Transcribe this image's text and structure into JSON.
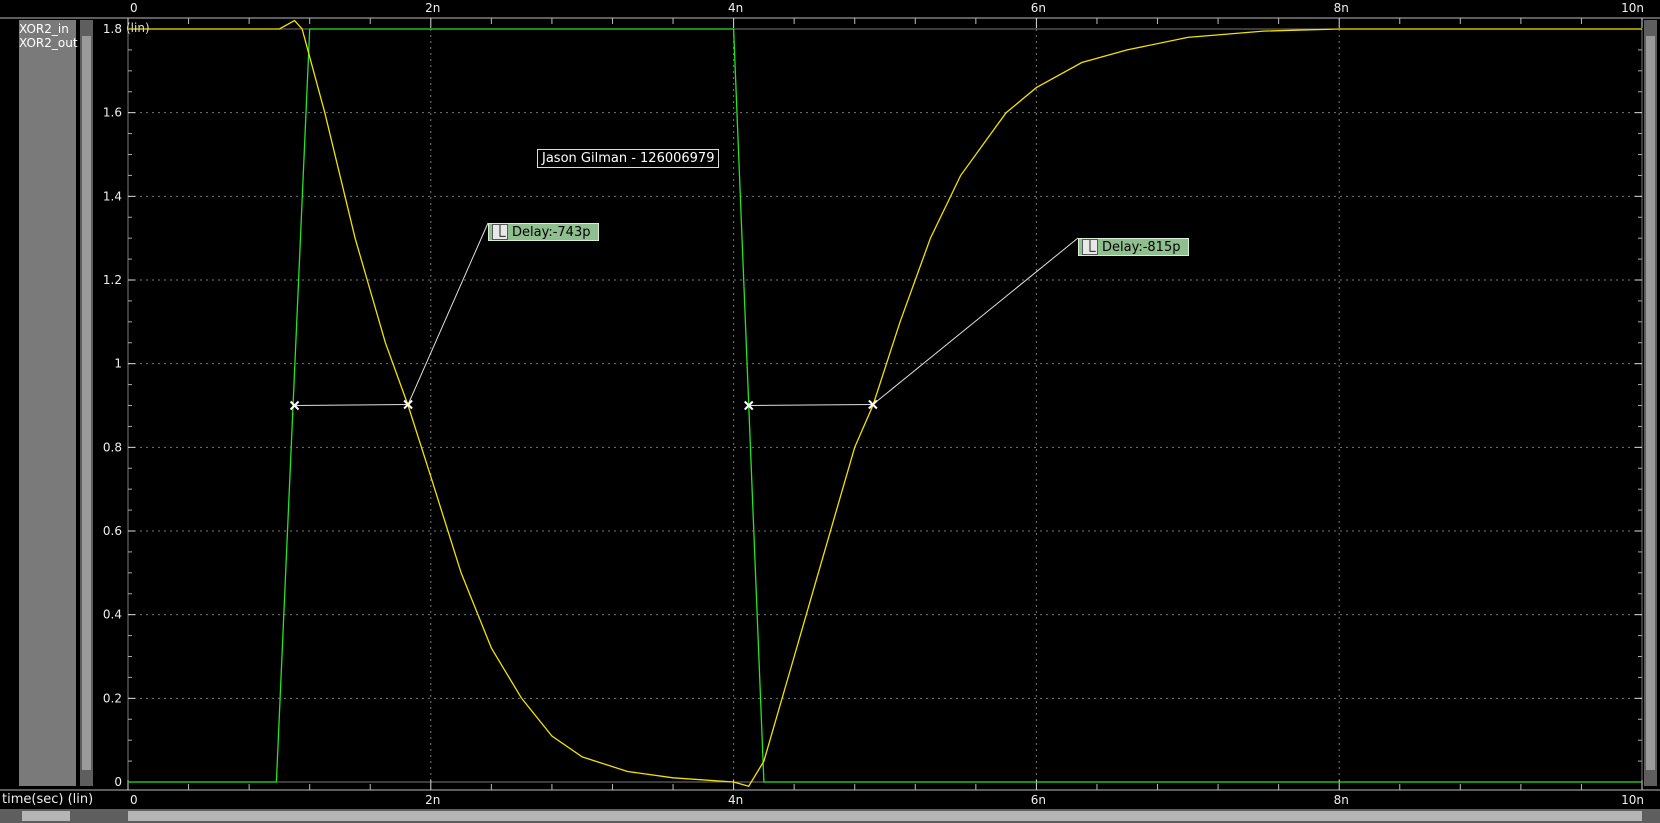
{
  "legend": [
    {
      "name": "XOR2_in",
      "color": "#22e622"
    },
    {
      "name": "XOR2_out",
      "color": "#f2e200"
    }
  ],
  "y_scale_label": "(lin)",
  "x_axis_label": "time(sec) (lin)",
  "annotation": "Jason Gilman - 126006979",
  "measurements": [
    {
      "label": "Delay:-743p",
      "t1": 1.1,
      "t2": 1.85,
      "y": 0.9
    },
    {
      "label": "Delay:-815p",
      "t1": 4.1,
      "t2": 4.92,
      "y": 0.9
    }
  ],
  "chart_data": {
    "type": "line",
    "xlabel": "time(sec) (lin)",
    "ylabel": "",
    "xlim": [
      0,
      10
    ],
    "ylim": [
      0,
      1.8
    ],
    "x_ticks": [
      "0",
      "2n",
      "4n",
      "6n",
      "8n",
      "10n"
    ],
    "y_ticks": [
      "0",
      "0.2",
      "0.4",
      "0.6",
      "0.8",
      "1",
      "1.2",
      "1.4",
      "1.6",
      "1.8"
    ],
    "grid": true,
    "series": [
      {
        "name": "XOR2_in",
        "color": "#22e622",
        "x": [
          0,
          0.98,
          1.2,
          4.0,
          4.2,
          10
        ],
        "y": [
          0,
          0,
          1.8,
          1.8,
          0,
          0
        ]
      },
      {
        "name": "XOR2_out",
        "color": "#f2e200",
        "x": [
          0,
          1.0,
          1.1,
          1.15,
          1.3,
          1.5,
          1.7,
          1.85,
          2.0,
          2.2,
          2.4,
          2.6,
          2.8,
          3.0,
          3.3,
          3.6,
          4.0,
          4.1,
          4.2,
          4.4,
          4.6,
          4.8,
          4.92,
          5.1,
          5.3,
          5.5,
          5.8,
          6.0,
          6.3,
          6.6,
          7.0,
          7.5,
          8.0,
          10
        ],
        "y": [
          1.8,
          1.8,
          1.82,
          1.8,
          1.6,
          1.3,
          1.05,
          0.9,
          0.73,
          0.5,
          0.32,
          0.2,
          0.11,
          0.06,
          0.025,
          0.01,
          0.0,
          -0.01,
          0.05,
          0.3,
          0.55,
          0.8,
          0.9,
          1.1,
          1.3,
          1.45,
          1.6,
          1.66,
          1.72,
          1.75,
          1.78,
          1.795,
          1.8,
          1.8
        ]
      }
    ]
  }
}
